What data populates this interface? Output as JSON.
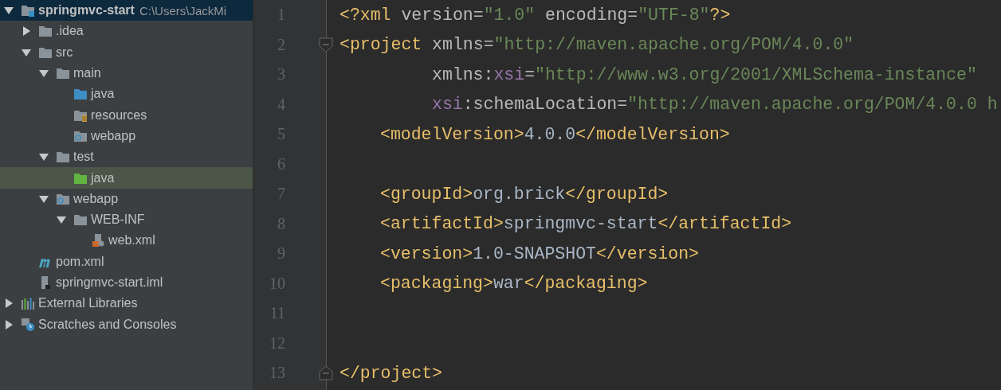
{
  "project_tree": {
    "items": [
      {
        "kind": "module",
        "name": "springmvc-start",
        "path": "C:\\Users\\JackMi",
        "expanded": true,
        "selected": false,
        "children": [
          {
            "kind": "folder",
            "name": ".idea",
            "expanded": false,
            "selected": false
          },
          {
            "kind": "folder",
            "name": "src",
            "expanded": true,
            "selected": false,
            "children": [
              {
                "kind": "folder",
                "name": "main",
                "expanded": true,
                "selected": false,
                "children": [
                  {
                    "kind": "source",
                    "name": "java",
                    "selected": false
                  },
                  {
                    "kind": "resources",
                    "name": "resources",
                    "selected": false
                  },
                  {
                    "kind": "web",
                    "name": "webapp",
                    "selected": false
                  }
                ]
              },
              {
                "kind": "folder",
                "name": "test",
                "expanded": true,
                "selected": false,
                "children": [
                  {
                    "kind": "test",
                    "name": "java",
                    "selected": true
                  }
                ]
              },
              {
                "kind": "web",
                "name": "webapp",
                "expanded": true,
                "selected": false,
                "children": [
                  {
                    "kind": "folder",
                    "name": "WEB-INF",
                    "expanded": true,
                    "selected": false,
                    "children": [
                      {
                        "kind": "xml",
                        "name": "web.xml",
                        "selected": false
                      }
                    ]
                  }
                ]
              }
            ]
          },
          {
            "kind": "maven",
            "name": "pom.xml",
            "selected": false
          },
          {
            "kind": "iml",
            "name": "springmvc-start.iml",
            "selected": false
          }
        ]
      },
      {
        "kind": "libraries",
        "name": "External Libraries",
        "expanded": false,
        "selected": false
      },
      {
        "kind": "scratches",
        "name": "Scratches and Consoles",
        "expanded": false,
        "selected": false
      }
    ]
  },
  "editor": {
    "lines": [
      {
        "number": "1",
        "kind": "declaration",
        "tokens": [
          {
            "kind": "tag",
            "text": "<?xml"
          },
          {
            "kind": "attr",
            "text": " version="
          },
          {
            "kind": "value",
            "text": "\"1.0\""
          },
          {
            "kind": "attr",
            "text": " encoding="
          },
          {
            "kind": "value",
            "text": "\"UTF-8\""
          },
          {
            "kind": "tag",
            "text": "?>"
          }
        ]
      },
      {
        "number": "2",
        "kind": "open",
        "tokens": [
          {
            "kind": "tag",
            "text": "<project"
          },
          {
            "kind": "attr",
            "text": " xmlns="
          },
          {
            "kind": "value",
            "text": "\"http://maven.apache.org/POM/4.0.0\""
          }
        ]
      },
      {
        "number": "3",
        "kind": "attribute",
        "tokens": [
          {
            "kind": "attr",
            "text": "xmlns:"
          },
          {
            "kind": "ns",
            "text": "xsi"
          },
          {
            "kind": "attr",
            "text": "="
          },
          {
            "kind": "value",
            "text": "\"http://www.w3.org/2001/XMLSchema-instance\""
          }
        ]
      },
      {
        "number": "4",
        "kind": "attribute",
        "tokens": [
          {
            "kind": "ns",
            "text": "xsi"
          },
          {
            "kind": "attr",
            "text": ":schemaLocation="
          },
          {
            "kind": "value",
            "text": "\"http://maven.apache.org/POM/4.0.0 h"
          }
        ]
      },
      {
        "number": "5",
        "kind": "child",
        "tokens": [
          {
            "kind": "tag",
            "text": "<modelVersion>"
          },
          {
            "kind": "text",
            "text": "4.0.0"
          },
          {
            "kind": "tag",
            "text": "</modelVersion>"
          }
        ]
      },
      {
        "number": "6",
        "kind": "blank"
      },
      {
        "number": "7",
        "kind": "child",
        "tokens": [
          {
            "kind": "tag",
            "text": "<groupId>"
          },
          {
            "kind": "text",
            "text": "org.brick"
          },
          {
            "kind": "tag",
            "text": "</groupId>"
          }
        ]
      },
      {
        "number": "8",
        "kind": "child",
        "tokens": [
          {
            "kind": "tag",
            "text": "<artifactId>"
          },
          {
            "kind": "text",
            "text": "springmvc-start"
          },
          {
            "kind": "tag",
            "text": "</artifactId>"
          }
        ]
      },
      {
        "number": "9",
        "kind": "child",
        "tokens": [
          {
            "kind": "tag",
            "text": "<version>"
          },
          {
            "kind": "text",
            "text": "1.0-SNAPSHOT"
          },
          {
            "kind": "tag",
            "text": "</version>"
          }
        ]
      },
      {
        "number": "10",
        "kind": "child",
        "tokens": [
          {
            "kind": "tag",
            "text": "<packaging>"
          },
          {
            "kind": "text",
            "text": "war"
          },
          {
            "kind": "tag",
            "text": "</packaging>"
          }
        ]
      },
      {
        "number": "11",
        "kind": "blank"
      },
      {
        "number": "12",
        "kind": "blank"
      },
      {
        "number": "13",
        "kind": "close",
        "tokens": [
          {
            "kind": "tag",
            "text": "</project>"
          }
        ]
      }
    ]
  }
}
